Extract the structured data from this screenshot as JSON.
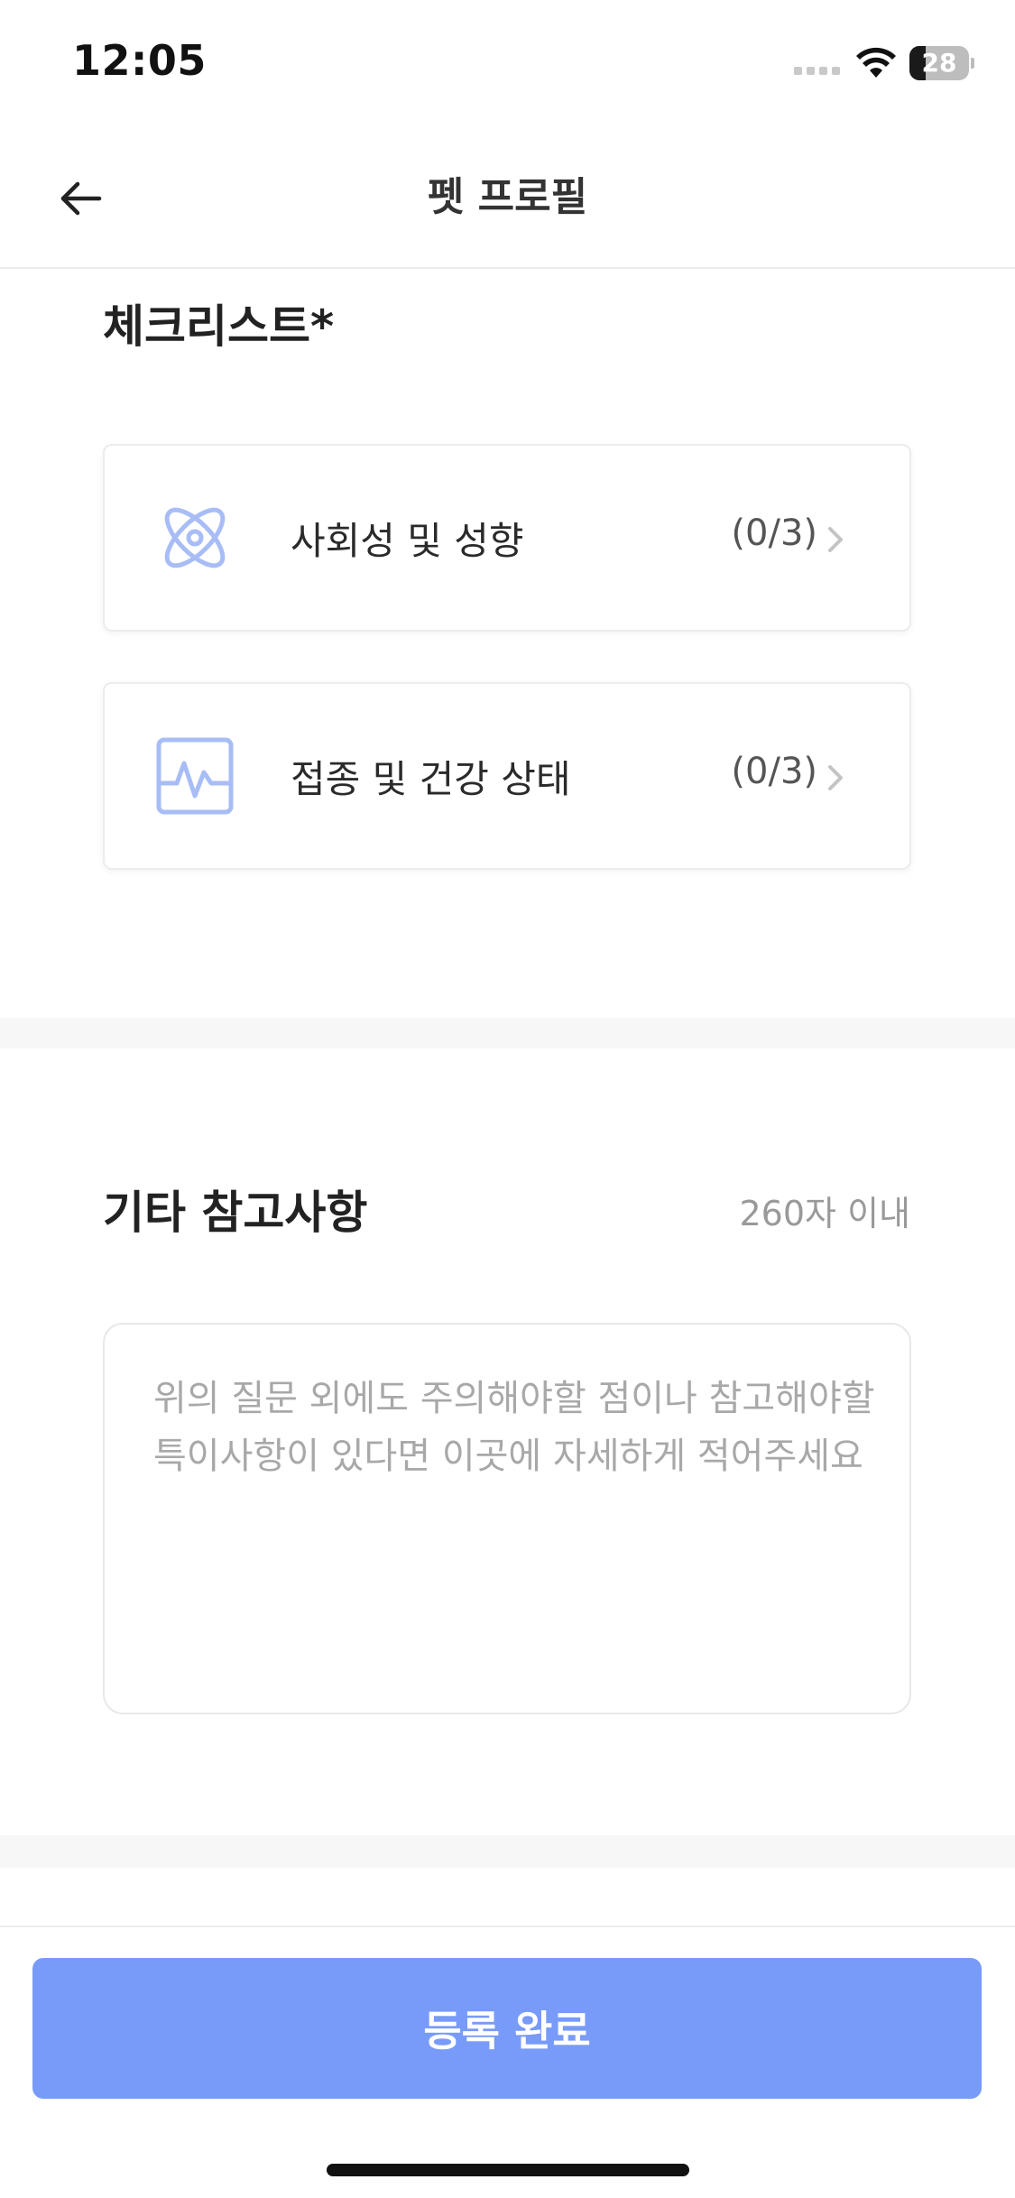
{
  "status_bar": {
    "time": "12:05",
    "battery_level": "28",
    "battery_fraction": 0.28,
    "icons": [
      "signal-dots-icon",
      "wifi-icon",
      "battery-icon"
    ]
  },
  "header": {
    "title": "펫 프로필",
    "back_icon": "arrow-left-icon"
  },
  "checklist": {
    "title": "체크리스트*",
    "items": [
      {
        "label": "사회성 및 성향",
        "count": "(0/3)",
        "icon": "atom-icon",
        "trailing_icon": "chevron-right-icon"
      },
      {
        "label": "접종 및 건강 상태",
        "count": "(0/3)",
        "icon": "health-monitor-icon",
        "trailing_icon": "chevron-right-icon"
      }
    ]
  },
  "notes": {
    "title": "기타 참고사항",
    "limit": "260자 이내",
    "value": "",
    "placeholder": "위의 질문 외에도 주의해야할 점이나 참고해야할 특이사항이 있다면 이곳에 자세하게 적어주세요"
  },
  "footer": {
    "submit_label": "등록 완료"
  },
  "colors": {
    "accent": "#789bfa",
    "icon_blue": "#a8bdf6",
    "divider": "#ececec",
    "muted_text": "#999999"
  }
}
